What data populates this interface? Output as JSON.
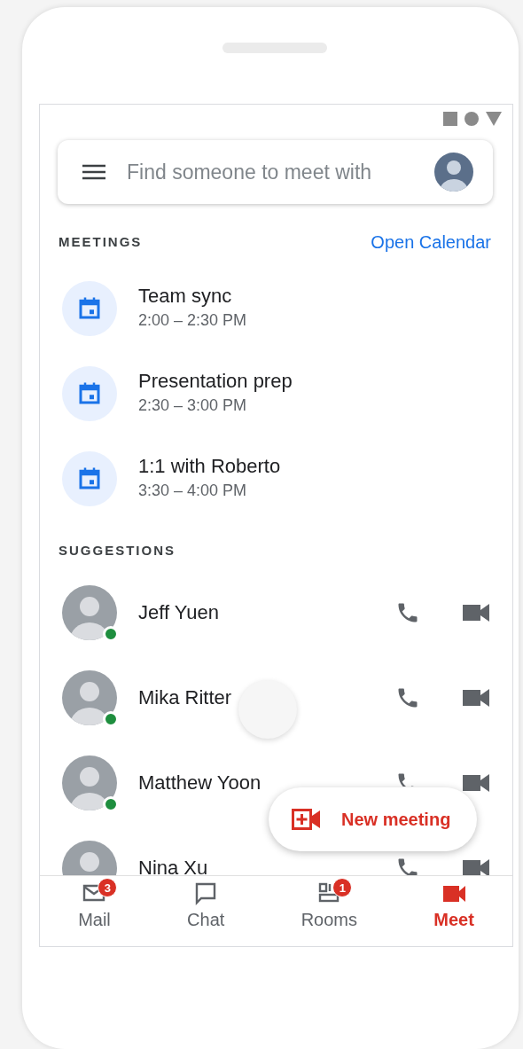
{
  "search": {
    "placeholder": "Find someone to meet with"
  },
  "meetings": {
    "heading": "MEETINGS",
    "link": "Open Calendar",
    "items": [
      {
        "title": "Team sync",
        "time": "2:00 – 2:30 PM"
      },
      {
        "title": "Presentation prep",
        "time": "2:30 – 3:00 PM"
      },
      {
        "title": "1:1 with Roberto",
        "time": "3:30 – 4:00 PM"
      }
    ]
  },
  "suggestions": {
    "heading": "SUGGESTIONS",
    "contacts": [
      {
        "name": "Jeff Yuen",
        "online": true
      },
      {
        "name": "Mika Ritter",
        "online": true
      },
      {
        "name": "Matthew Yoon",
        "online": true
      },
      {
        "name": "Nina Xu",
        "online": false
      }
    ]
  },
  "fab": {
    "label": "New meeting"
  },
  "nav": [
    {
      "kind": "mail",
      "label": "Mail",
      "badge": "3",
      "selected": false
    },
    {
      "kind": "chat",
      "label": "Chat",
      "selected": false
    },
    {
      "kind": "rooms",
      "label": "Rooms",
      "badge": "1",
      "selected": false
    },
    {
      "kind": "meet",
      "label": "Meet",
      "selected": true
    }
  ]
}
